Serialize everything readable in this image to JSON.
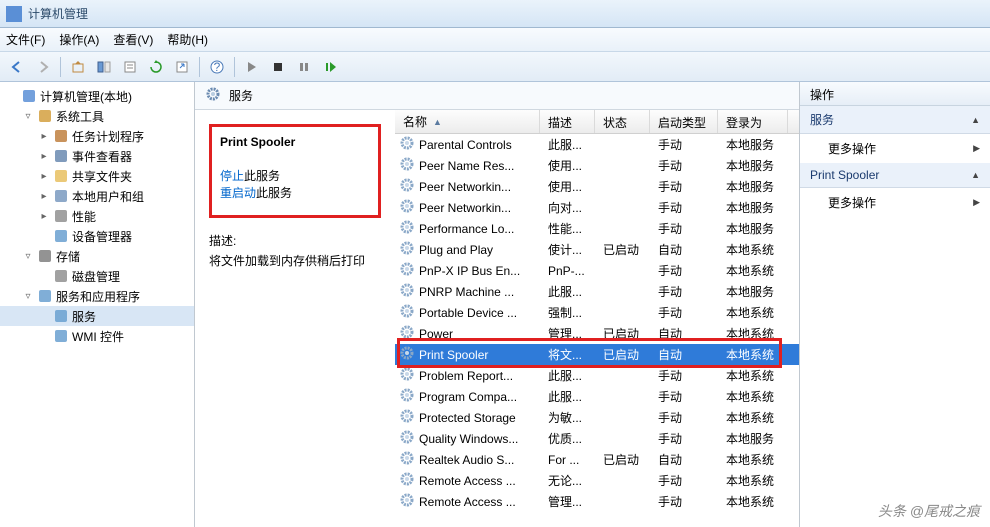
{
  "title": "计算机管理",
  "menubar": [
    "文件(F)",
    "操作(A)",
    "查看(V)",
    "帮助(H)"
  ],
  "tree": [
    {
      "ind": 0,
      "tw": "",
      "icon": "mgmt",
      "label": "计算机管理(本地)"
    },
    {
      "ind": 1,
      "tw": "▿",
      "icon": "wrench",
      "label": "系统工具"
    },
    {
      "ind": 2,
      "tw": "▸",
      "icon": "clock",
      "label": "任务计划程序"
    },
    {
      "ind": 2,
      "tw": "▸",
      "icon": "event",
      "label": "事件查看器"
    },
    {
      "ind": 2,
      "tw": "▸",
      "icon": "folder",
      "label": "共享文件夹"
    },
    {
      "ind": 2,
      "tw": "▸",
      "icon": "users",
      "label": "本地用户和组"
    },
    {
      "ind": 2,
      "tw": "▸",
      "icon": "perf",
      "label": "性能"
    },
    {
      "ind": 2,
      "tw": "",
      "icon": "device",
      "label": "设备管理器"
    },
    {
      "ind": 1,
      "tw": "▿",
      "icon": "storage",
      "label": "存储"
    },
    {
      "ind": 2,
      "tw": "",
      "icon": "disk",
      "label": "磁盘管理"
    },
    {
      "ind": 1,
      "tw": "▿",
      "icon": "services",
      "label": "服务和应用程序"
    },
    {
      "ind": 2,
      "tw": "",
      "icon": "gear",
      "label": "服务",
      "sel": true
    },
    {
      "ind": 2,
      "tw": "",
      "icon": "wmi",
      "label": "WMI 控件"
    }
  ],
  "mid_title": "服务",
  "detail": {
    "name": "Print Spooler",
    "stop_link": "停止",
    "stop_suffix": "此服务",
    "restart_link": "重启动",
    "restart_suffix": "此服务",
    "desc_label": "描述:",
    "desc": "将文件加载到内存供稍后打印"
  },
  "columns": {
    "name": "名称",
    "desc": "描述",
    "stat": "状态",
    "start": "启动类型",
    "logon": "登录为"
  },
  "rows": [
    {
      "name": "Parental Controls",
      "desc": "此服...",
      "stat": "",
      "start": "手动",
      "logon": "本地服务"
    },
    {
      "name": "Peer Name Res...",
      "desc": "使用...",
      "stat": "",
      "start": "手动",
      "logon": "本地服务"
    },
    {
      "name": "Peer Networkin...",
      "desc": "使用...",
      "stat": "",
      "start": "手动",
      "logon": "本地服务"
    },
    {
      "name": "Peer Networkin...",
      "desc": "向对...",
      "stat": "",
      "start": "手动",
      "logon": "本地服务"
    },
    {
      "name": "Performance Lo...",
      "desc": "性能...",
      "stat": "",
      "start": "手动",
      "logon": "本地服务"
    },
    {
      "name": "Plug and Play",
      "desc": "使计...",
      "stat": "已启动",
      "start": "自动",
      "logon": "本地系统"
    },
    {
      "name": "PnP-X IP Bus En...",
      "desc": "PnP-...",
      "stat": "",
      "start": "手动",
      "logon": "本地系统"
    },
    {
      "name": "PNRP Machine ...",
      "desc": "此服...",
      "stat": "",
      "start": "手动",
      "logon": "本地服务"
    },
    {
      "name": "Portable Device ...",
      "desc": "强制...",
      "stat": "",
      "start": "手动",
      "logon": "本地系统"
    },
    {
      "name": "Power",
      "desc": "管理...",
      "stat": "已启动",
      "start": "自动",
      "logon": "本地系统"
    },
    {
      "name": "Print Spooler",
      "desc": "将文...",
      "stat": "已启动",
      "start": "自动",
      "logon": "本地系统",
      "sel": true
    },
    {
      "name": "Problem Report...",
      "desc": "此服...",
      "stat": "",
      "start": "手动",
      "logon": "本地系统"
    },
    {
      "name": "Program Compa...",
      "desc": "此服...",
      "stat": "",
      "start": "手动",
      "logon": "本地系统"
    },
    {
      "name": "Protected Storage",
      "desc": "为敏...",
      "stat": "",
      "start": "手动",
      "logon": "本地系统"
    },
    {
      "name": "Quality Windows...",
      "desc": "优质...",
      "stat": "",
      "start": "手动",
      "logon": "本地服务"
    },
    {
      "name": "Realtek Audio S...",
      "desc": "For ...",
      "stat": "已启动",
      "start": "自动",
      "logon": "本地系统"
    },
    {
      "name": "Remote Access ...",
      "desc": "无论...",
      "stat": "",
      "start": "手动",
      "logon": "本地系统"
    },
    {
      "name": "Remote Access ...",
      "desc": "管理...",
      "stat": "",
      "start": "手动",
      "logon": "本地系统"
    }
  ],
  "actions": {
    "header": "操作",
    "section1": "服务",
    "more": "更多操作",
    "section2": "Print Spooler"
  },
  "watermark": "头条 @尾戒之痕"
}
